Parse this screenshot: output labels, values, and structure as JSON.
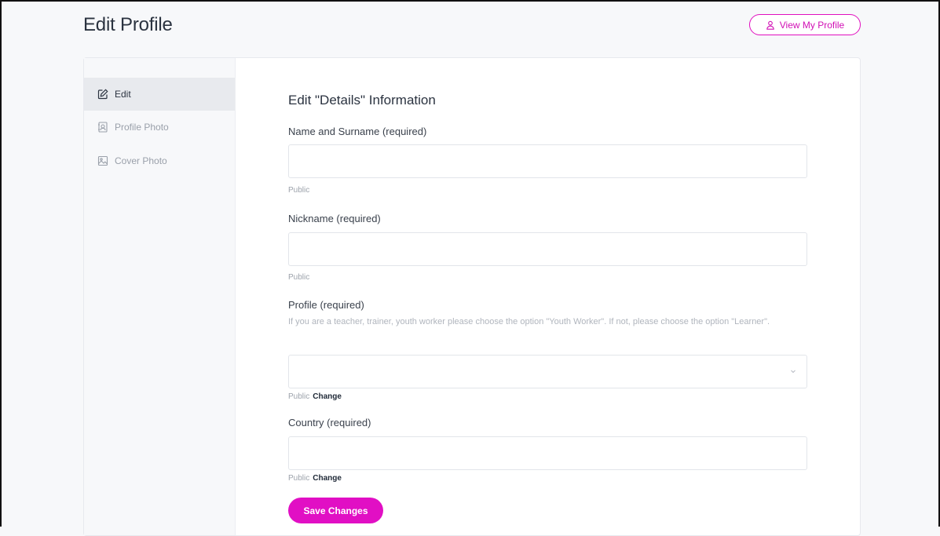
{
  "header": {
    "title": "Edit Profile",
    "view_profile_label": "View My Profile"
  },
  "sidebar": {
    "items": [
      {
        "label": "Edit",
        "icon": "edit-icon",
        "active": true
      },
      {
        "label": "Profile Photo",
        "icon": "profile-photo-icon",
        "active": false
      },
      {
        "label": "Cover Photo",
        "icon": "image-icon",
        "active": false
      }
    ]
  },
  "form": {
    "section_title": "Edit \"Details\" Information",
    "fields": {
      "name": {
        "label": "Name and Surname (required)",
        "value": "",
        "visibility": "Public"
      },
      "nickname": {
        "label": "Nickname (required)",
        "value": "",
        "visibility": "Public"
      },
      "profile": {
        "label": "Profile (required)",
        "hint": "If you are a teacher, trainer, youth worker please choose the option \"Youth Worker\". If not, please choose the option \"Learner\".",
        "value": "",
        "visibility": "Public",
        "change_label": "Change"
      },
      "country": {
        "label": "Country (required)",
        "value": "",
        "visibility": "Public",
        "change_label": "Change"
      }
    },
    "save_label": "Save Changes"
  },
  "colors": {
    "accent": "#e10fc4",
    "background": "#f7f8fa",
    "card": "#ffffff",
    "sidebar_active": "#e8eaee"
  }
}
